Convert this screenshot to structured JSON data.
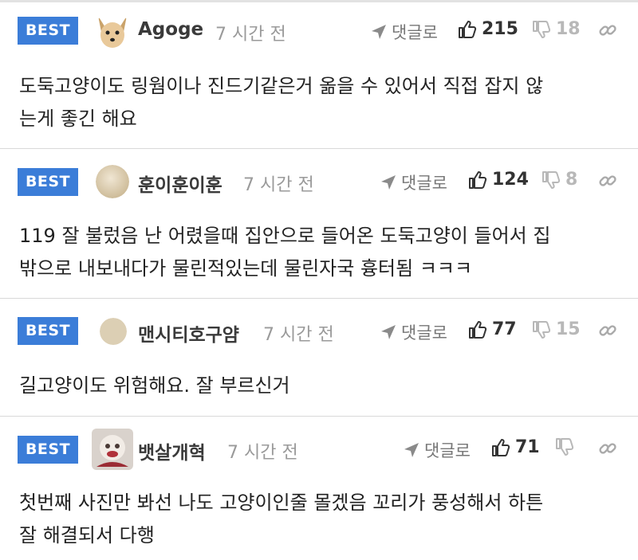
{
  "comments": [
    {
      "badge": "BEST",
      "username": "Agoge",
      "time": "7 시간 전",
      "reply_label": "댓글로",
      "likes": "215",
      "dislikes": "18",
      "body_lines": [
        "도둑고양이도 링웜이나 진드기같은거 옮을 수 있어서 직접 잡지 않",
        "는게 좋긴 해요"
      ]
    },
    {
      "badge": "BEST",
      "username": "훈이훈이훈",
      "time": "7 시간 전",
      "reply_label": "댓글로",
      "likes": "124",
      "dislikes": "8",
      "body_lines": [
        "119 잘 불렀음 난 어렸을때 집안으로 들어온 도둑고양이 들어서 집",
        "밖으로 내보내다가 물린적있는데 물린자국 흉터됨 ㅋㅋㅋ"
      ]
    },
    {
      "badge": "BEST",
      "username": "맨시티호구얌",
      "time": "7 시간 전",
      "reply_label": "댓글로",
      "likes": "77",
      "dislikes": "15",
      "body_lines": [
        "길고양이도 위험해요. 잘 부르신거"
      ]
    },
    {
      "badge": "BEST",
      "username": "뱃살개혁",
      "time": "7 시간 전",
      "reply_label": "댓글로",
      "likes": "71",
      "dislikes": "",
      "body_lines": [
        "첫번째 사진만 봐선 나도 고양이인줄 몰겠음 꼬리가 풍성해서 하튼",
        "잘 해결되서 다행"
      ]
    }
  ],
  "colors": {
    "badge": "#3b7dd8",
    "muted": "#9a9a9a",
    "divider": "#d9d9d9"
  },
  "icons": [
    "cursor-arrow-icon",
    "thumbs-up-icon",
    "thumbs-down-icon",
    "link-icon"
  ]
}
